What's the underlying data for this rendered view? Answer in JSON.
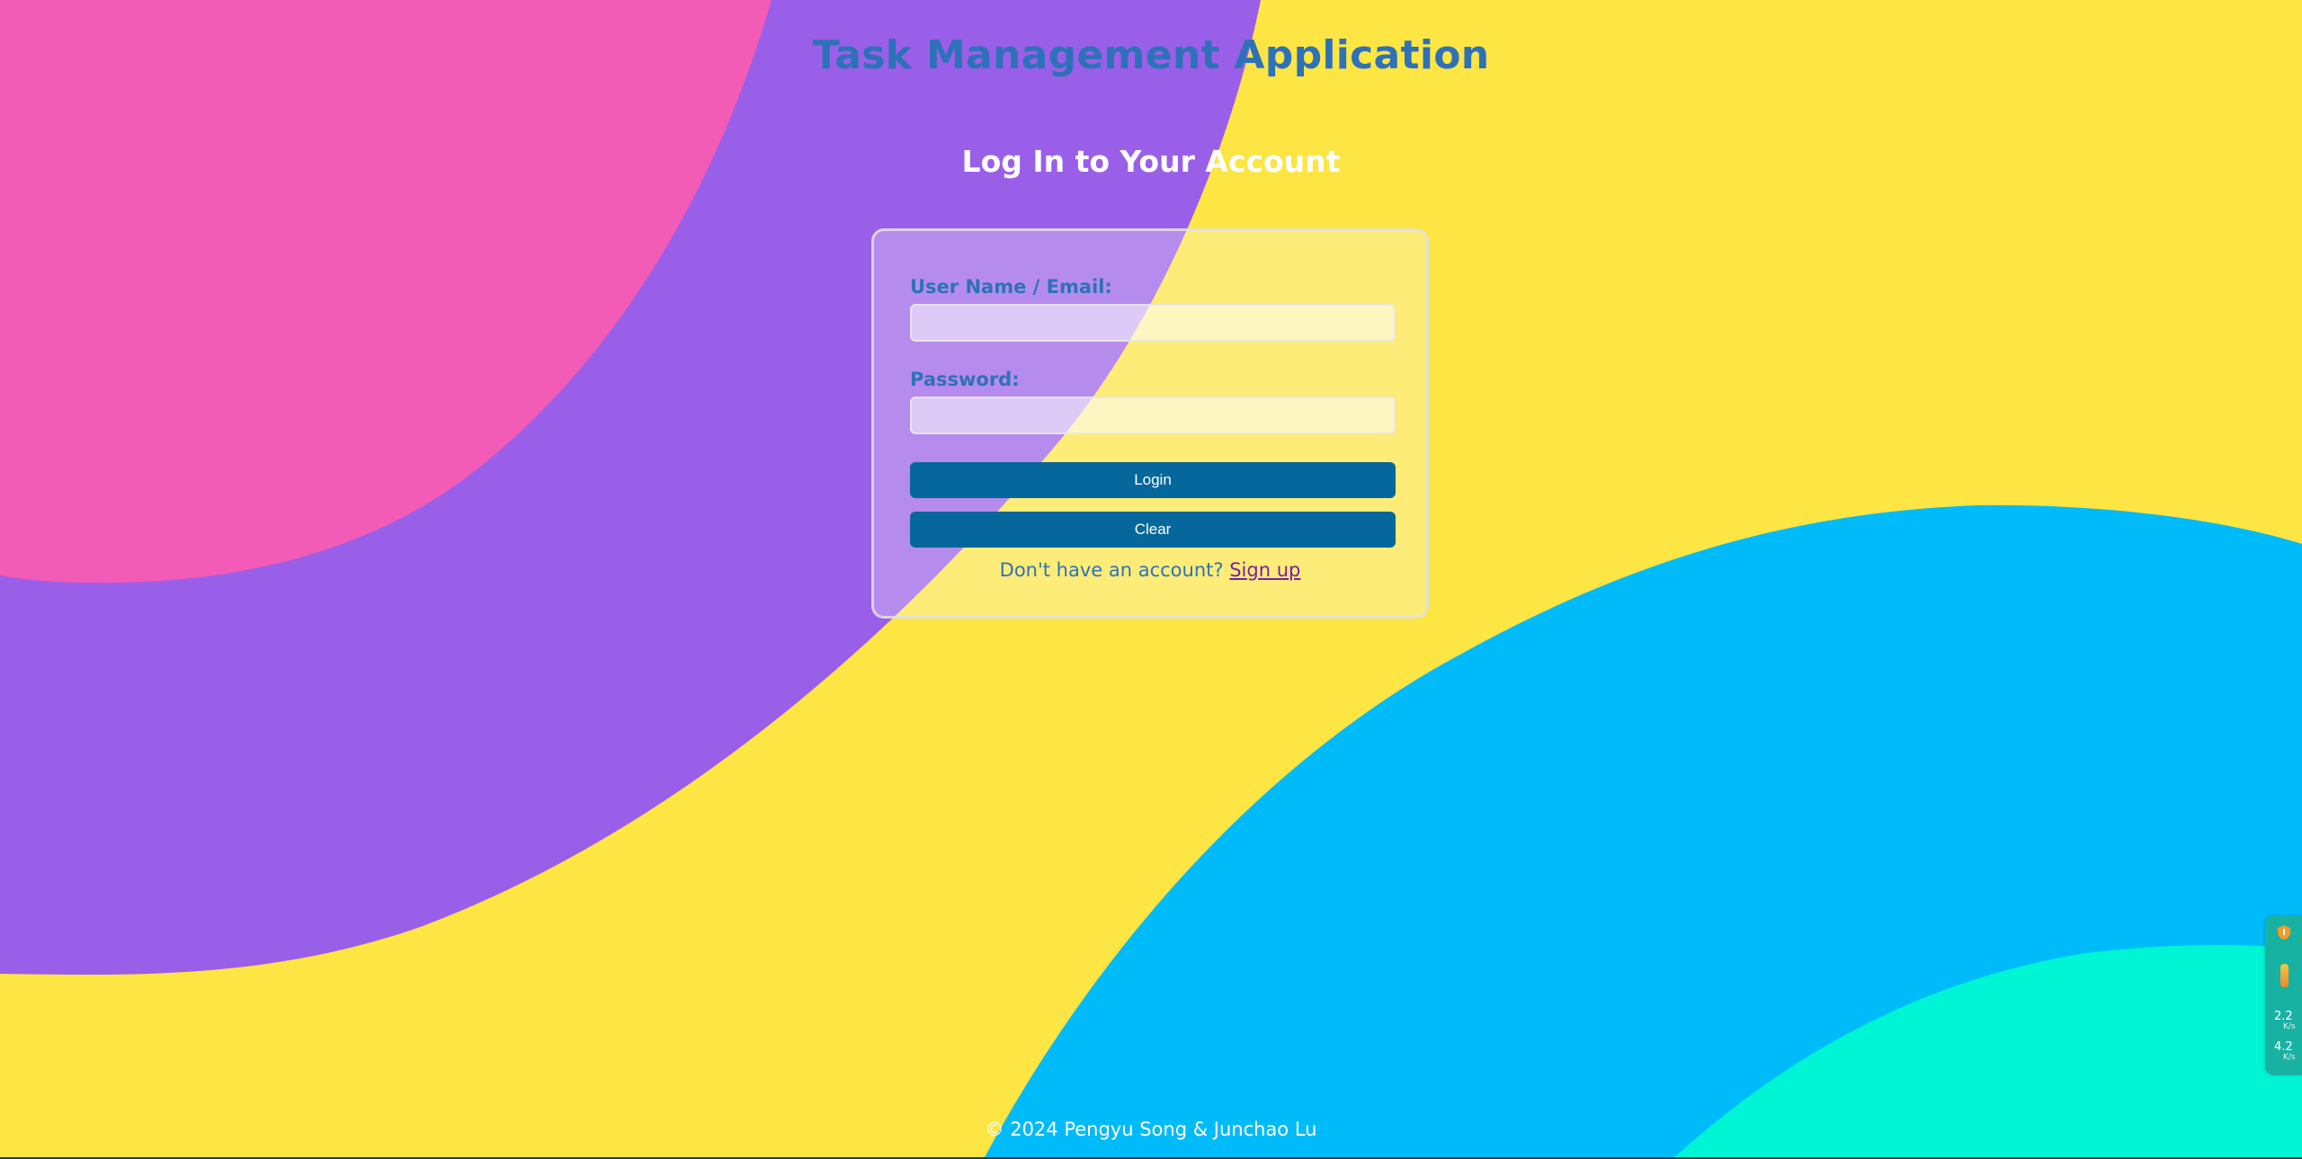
{
  "header": {
    "app_title": "Task Management Application",
    "login_heading": "Log In to Your Account"
  },
  "login_form": {
    "username_label": "User Name / Email:",
    "username_value": "",
    "password_label": "Password:",
    "password_value": "",
    "login_button": "Login",
    "clear_button": "Clear",
    "signup_prompt": "Don't have an account?",
    "signup_link": "Sign up"
  },
  "footer": {
    "copyright": "© 2024 Pengyu Song & Junchao Lu"
  },
  "network_widget": {
    "speed_1": "2.2",
    "unit_1": "K/s",
    "speed_2": "4.2",
    "unit_2": "K/s"
  },
  "colors": {
    "background_yellow": "#fde543",
    "blob_pink": "#f25bb6",
    "blob_purple": "#9a5fe8",
    "blob_blue": "#00bbf9",
    "blob_aqua": "#00f5d4",
    "title_blue": "#2d72b8",
    "button_blue": "#05679c"
  }
}
